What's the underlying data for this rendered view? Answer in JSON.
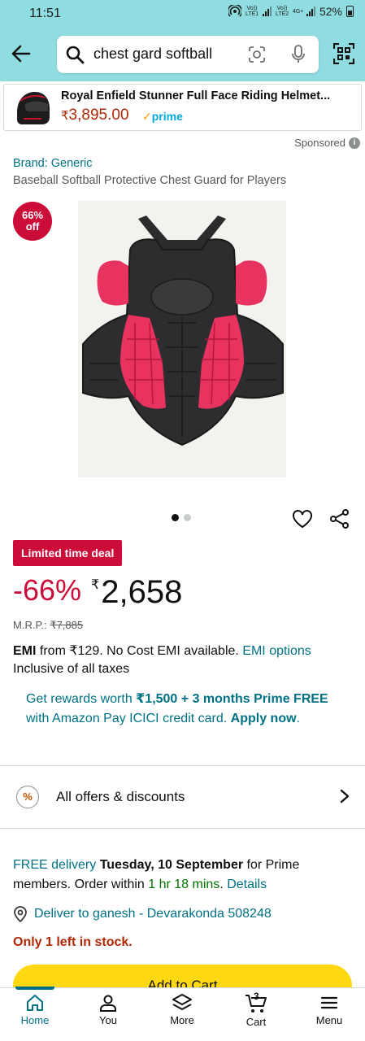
{
  "status": {
    "time": "11:51",
    "sim1": "Vo)) LTE1",
    "sim2": "Vo)) LTE2",
    "network": "4G+",
    "battery": "52%"
  },
  "search": {
    "query": "chest gard softball"
  },
  "sponsored_ad": {
    "title": "Royal Enfield Stunner Full Face Riding Helmet...",
    "currency": "₹",
    "price": "3,895.00",
    "prime": "prime"
  },
  "sponsored_label": "Sponsored",
  "product": {
    "brand": "Brand: Generic",
    "title": "Baseball Softball Protective Chest Guard for Players",
    "badge_line1": "66%",
    "badge_line2": "off",
    "image_count": 2,
    "active_image": 1,
    "deal_label": "Limited time deal",
    "discount": "-66%",
    "currency": "₹",
    "price": "2,658",
    "mrp_label": "M.R.P.:",
    "mrp_value": "₹7,885"
  },
  "emi": {
    "lead": "EMI",
    "text": " from ₹129. No Cost EMI available. ",
    "link": "EMI options",
    "tax": "Inclusive of all taxes"
  },
  "rewards": {
    "part1": "Get rewards worth ",
    "amount": "₹1,500 + 3 months Prime FREE",
    "part2": " with Amazon Pay ICICI credit card. ",
    "apply": "Apply now",
    "end": "."
  },
  "offers": {
    "icon": "%",
    "label": "All offers & discounts"
  },
  "delivery": {
    "free": "FREE delivery",
    "date": " Tuesday, 10 September",
    "part2": " for Prime members. Order within ",
    "countdown": "1 hr 18 mins",
    "sep": ". ",
    "details": "Details"
  },
  "deliver_to": "Deliver to ganesh - Devarakonda 508248",
  "stock": "Only 1 left in stock.",
  "cart_button": "Add to Cart",
  "nav": {
    "home": "Home",
    "you": "You",
    "more": "More",
    "cart": "Cart",
    "cart_count": "3",
    "menu": "Menu"
  },
  "colors": {
    "header_bg": "#8fdde0",
    "deal_red": "#cc0c39",
    "link_teal": "#007185",
    "cart_yellow": "#ffd814",
    "price_red": "#b12704",
    "product_pink": "#e8325f"
  }
}
